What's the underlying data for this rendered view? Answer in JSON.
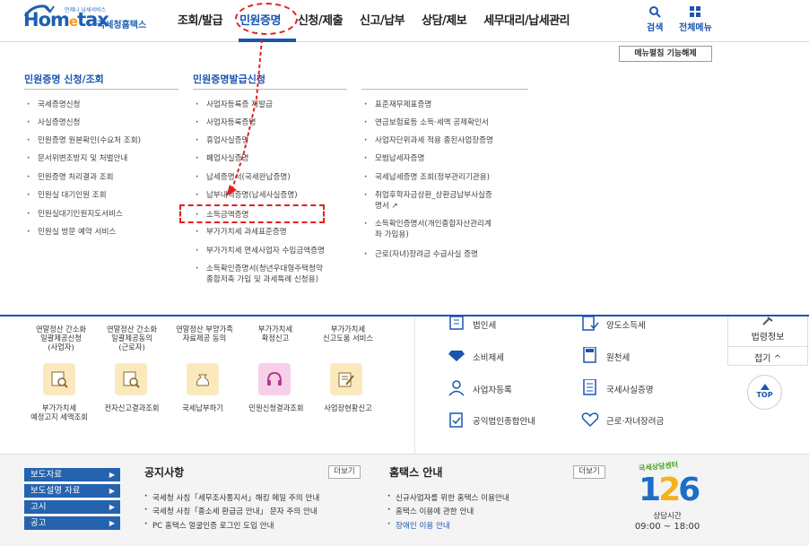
{
  "header": {
    "logo_tag": "언제나 납세서비스",
    "logo_home": "Hom",
    "logo_e": "e",
    "logo_tax": "tax",
    "logo_kr": "국세청홈택스",
    "nav": [
      "조회/발급",
      "민원증명",
      "신청/제출",
      "신고/납부",
      "상담/제보",
      "세무대리/납세관리"
    ],
    "search_label": "검색",
    "all_menu_label": "전체메뉴"
  },
  "mega": {
    "close_label": "메뉴펼침 기능해제",
    "col1_title": "민원증명 신청/조회",
    "col1": [
      "국세증명신청",
      "사실증명신청",
      "민원증명 원본확인(수요처 조회)",
      "문서위변조방지 및 처벌안내",
      "민원증명 처리결과 조회",
      "민원실 대기인원 조회",
      "민원실대기인원지도서비스",
      "민원실 방문 예약 서비스"
    ],
    "col2_title": "민원증명발급신청",
    "col2": [
      "사업자등록증 재발급",
      "사업자등록증명",
      "휴업사실증명",
      "폐업사실증명",
      "납세증명서(국세완납증명)",
      "납부내역증명(납세사실증명)",
      "소득금액증명",
      "부가가치세 과세표준증명",
      "부가가치세 면세사업자 수입금액증명",
      "소득확인증명서(청년우대형주택청약",
      "종합저축 가입 및 과세특례 신청용)"
    ],
    "col3": [
      "표준재무제표증명",
      "연금보험료등 소득·세액 공제확인서",
      "사업자단위과세 적용 종된사업장증명",
      "모범납세자증명",
      "국세납세증명 조회(정부관리기관용)",
      "취업후학자금상환_상환금납부사실증",
      "명서",
      "소득확인증명서(개인종합자산관리계",
      "좌 가입용)",
      "근로(자녀)장려금 수급사실 증명"
    ]
  },
  "services": {
    "top_row": [
      "연말정산 간소화",
      "일괄제공신청",
      "(사업자)",
      "연말정산 간소화",
      "일괄제공동의",
      "(근로자)",
      "연말정산 부양가족",
      "자료제공 동의",
      "부가가치세",
      "확정신고",
      "부가가치세",
      "신고도움 서비스"
    ],
    "icons": [
      {
        "label1": "부가가치세",
        "label2": "예정고지 세액조회"
      },
      {
        "label1": "전자신고결과조회",
        "label2": ""
      },
      {
        "label1": "국세납부하기",
        "label2": ""
      },
      {
        "label1": "민원신청결과조회",
        "label2": ""
      },
      {
        "label1": "사업장현황신고",
        "label2": ""
      }
    ]
  },
  "tax_menu": [
    "법인세",
    "양도소득세",
    "소비제세",
    "원천세",
    "사업자등록",
    "국세사실증명",
    "공익법인종합안내",
    "근로·자녀장려금"
  ],
  "side": {
    "law_label": "법령정보",
    "fold_label": "접기 ^",
    "top_label": "TOP"
  },
  "footer": {
    "quick": [
      "보도자료",
      "보도설명 자료",
      "고시",
      "공고"
    ],
    "notice_title": "공지사항",
    "notice_more": "더보기",
    "notices": [
      "국세청 사칭「세무조사통지서」해킹 메일 주의 안내",
      "국세청 사칭「종소세 환급금 안내」 문자 주의 안내",
      "PC 홈택스 얼굴인증 로그인 도입 안내"
    ],
    "guide_title": "홈택스 안내",
    "guide_more": "더보기",
    "guides": [
      "신규사업자를 위한 홈택스 이용안내",
      "홈택스 이용에 관한 안내",
      "장애인 이용 안내"
    ],
    "cc_label": "국세상담센터",
    "cc_num_a": "1",
    "cc_num_b": "2",
    "cc_num_c": "6",
    "cc_hours_title": "상담시간",
    "cc_hours": "09:00 ~ 18:00"
  },
  "colors": {
    "brand_blue": "#1a56b0",
    "annotation_red": "#e02020"
  }
}
